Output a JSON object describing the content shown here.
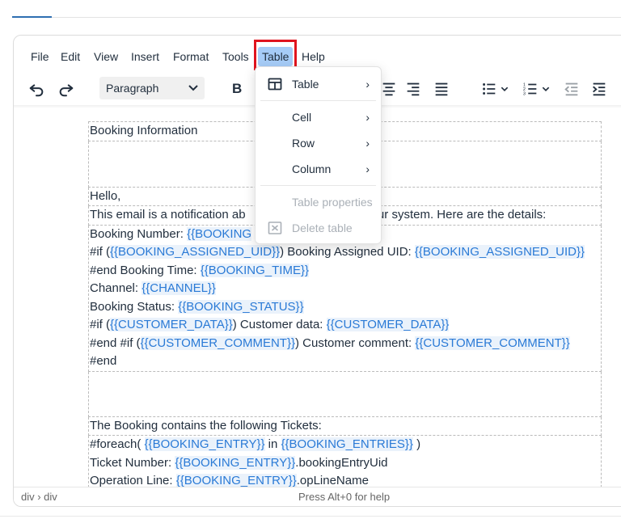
{
  "menubar": {
    "items": [
      "File",
      "Edit",
      "View",
      "Insert",
      "Format",
      "Tools",
      "Table",
      "Help"
    ],
    "active": "Table"
  },
  "toolbar": {
    "block_format": "Paragraph",
    "bold": "B"
  },
  "table_menu": {
    "table": "Table",
    "cell": "Cell",
    "row": "Row",
    "column": "Column",
    "table_properties": "Table properties",
    "delete_table": "Delete table"
  },
  "content": {
    "heading": "Booking Information",
    "hello": "Hello,",
    "notification": "This email is a notification ab",
    "notification_tail": "our system. Here are the details:",
    "line1_label": "Booking Number: ",
    "line1_tag": "{{BOOKING",
    "line2_a": "#if (",
    "line2_tag1": "{{BOOKING_ASSIGNED_UID}}",
    "line2_b": ") Booking Assigned UID: ",
    "line2_tag2": "{{BOOKING_ASSIGNED_UID}}",
    "line3_a": "#end Booking Time: ",
    "line3_tag": "{{BOOKING_TIME}}",
    "line4_a": "Channel: ",
    "line4_tag": "{{CHANNEL}}",
    "line5_a": "Booking Status: ",
    "line5_tag": "{{BOOKING_STATUS}}",
    "line6_a": "#if (",
    "line6_tag1": "{{CUSTOMER_DATA}}",
    "line6_b": ") Customer data: ",
    "line6_tag2": "{{CUSTOMER_DATA}}",
    "line7_a": "#end #if (",
    "line7_tag1": "{{CUSTOMER_COMMENT}}",
    "line7_b": ") Customer comment: ",
    "line7_tag2": "{{CUSTOMER_COMMENT}}",
    "line8": "#end",
    "tickets_heading": "The Booking contains the following Tickets:",
    "loop_a": "#foreach( ",
    "loop_tag1": "{{BOOKING_ENTRY}}",
    "loop_b": " in ",
    "loop_tag2": "{{BOOKING_ENTRIES}}",
    "loop_c": " )",
    "ticket_a": "Ticket Number: ",
    "ticket_tag": "{{BOOKING_ENTRY}}",
    "ticket_b": ".bookingEntryUid",
    "opline_a": "Operation Line: ",
    "opline_tag": "{{BOOKING_ENTRY}}",
    "opline_b": ".opLineName"
  },
  "statusbar": {
    "path": "div › div",
    "help": "Press Alt+0 for help"
  },
  "colors": {
    "accent": "#2f6fb1",
    "menu_active": "#a6ccf7",
    "highlight_border": "#e0141e",
    "template_tag": "#2a7ad6"
  }
}
